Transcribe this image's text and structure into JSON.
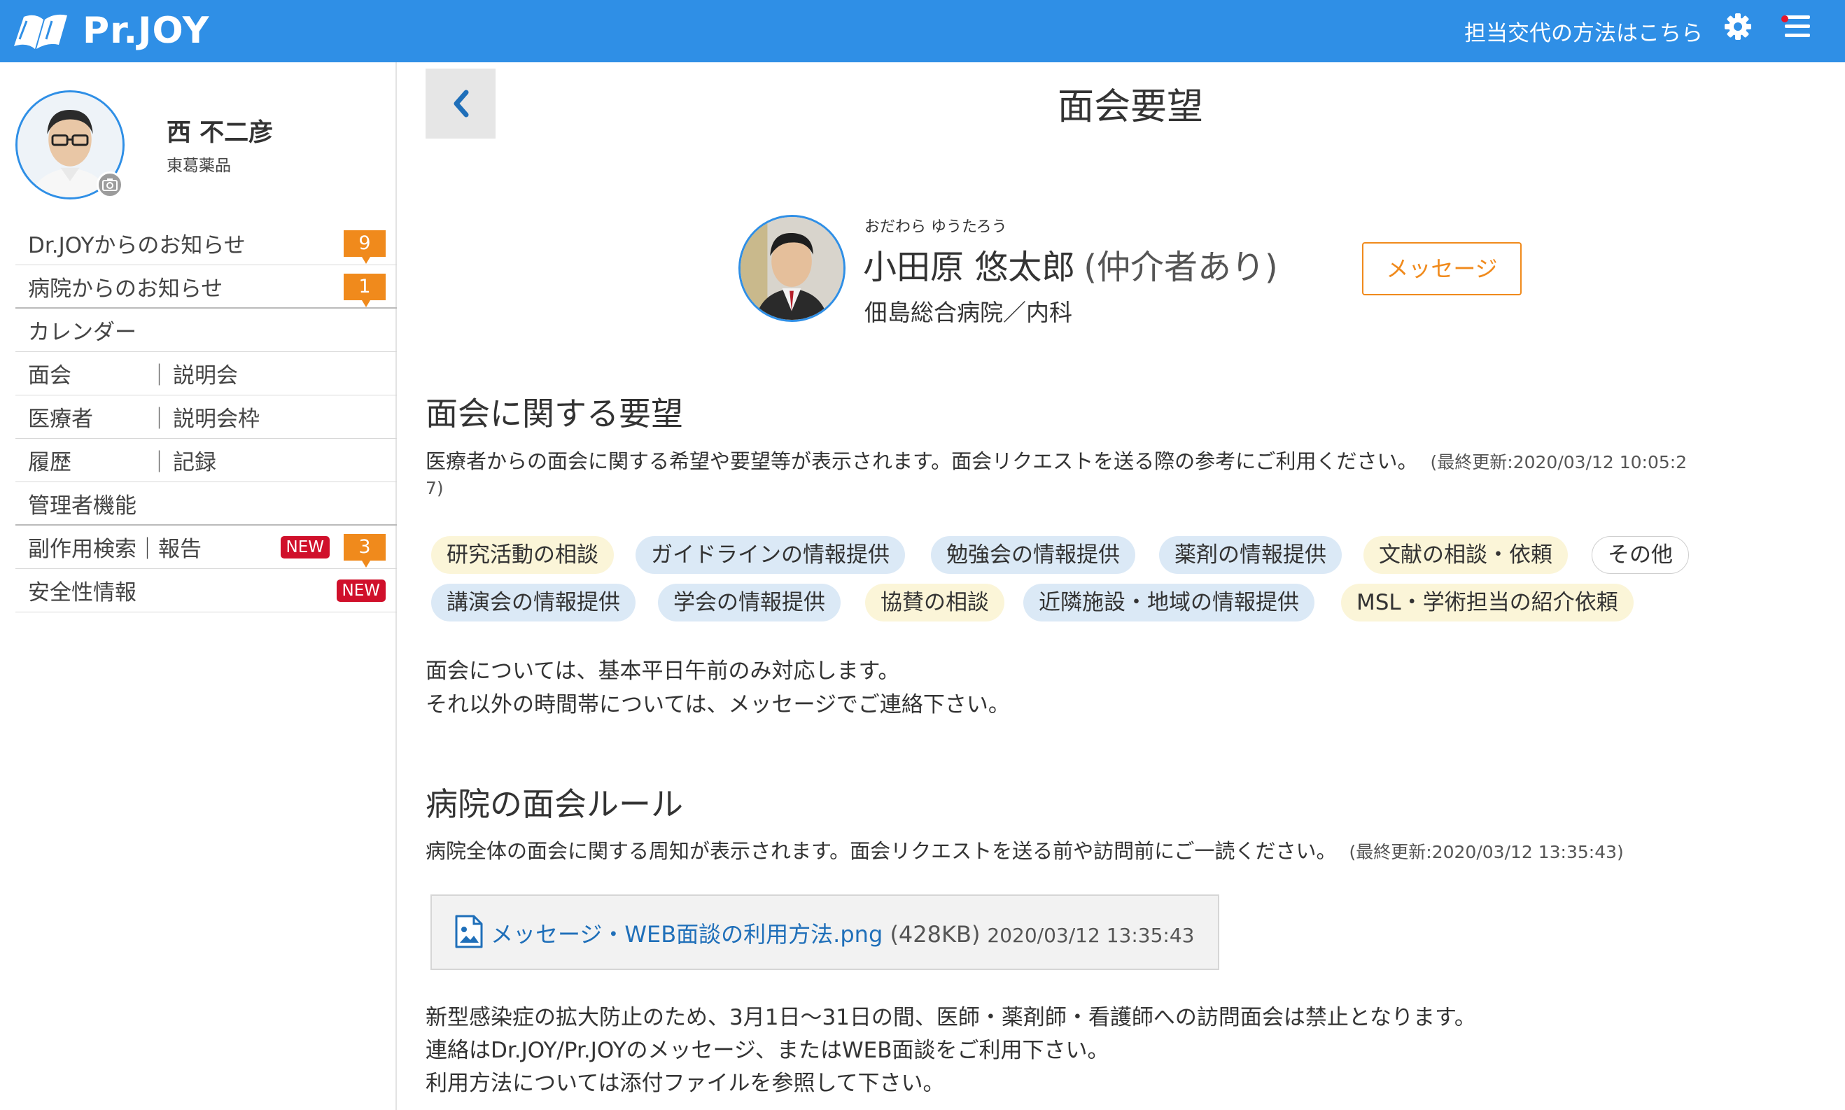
{
  "header": {
    "logo_text": "Pr.JOY",
    "change_link": "担当交代の方法はこちら",
    "settings_icon": "gear-icon",
    "menu_icon": "hamburger-menu-icon",
    "colors": {
      "primary": "#2f8fe6",
      "badge_orange": "#f08a1c",
      "badge_red": "#d0102b"
    }
  },
  "user": {
    "name": "西 不二彦",
    "company": "東葛薬品"
  },
  "sidebar": {
    "items": [
      {
        "label": "Dr.JOYからのお知らせ",
        "badge": "9"
      },
      {
        "label": "病院からのお知らせ",
        "badge": "1"
      },
      {
        "label": "カレンダー"
      },
      {
        "label": "面会",
        "sub": "説明会"
      },
      {
        "label": "医療者",
        "sub": "説明会枠"
      },
      {
        "label": "履歴",
        "sub": "記録"
      },
      {
        "label": "管理者機能"
      },
      {
        "label": "副作用検索｜報告",
        "new": "NEW",
        "badge": "3"
      },
      {
        "label": "安全性情報",
        "new": "NEW"
      }
    ]
  },
  "page": {
    "title": "面会要望"
  },
  "doctor": {
    "ruby": "おだわら ゆうたろう",
    "name": "小田原 悠太郎",
    "broker": "(仲介者あり)",
    "dept": "佃島総合病院／内科",
    "message_button": "メッセージ"
  },
  "requests": {
    "title": "面会に関する要望",
    "desc": "医療者からの面会に関する希望や要望等が表示されます。面会リクエストを送る際の参考にご利用ください。",
    "updated_1": "(最終更新:2020/03/12 10:05:2",
    "updated_2": "7)",
    "tags": [
      "研究活動の相談",
      "ガイドラインの情報提供",
      "勉強会の情報提供",
      "薬剤の情報提供",
      "文献の相談・依頼",
      "その他",
      "講演会の情報提供",
      "学会の情報提供",
      "協賛の相談",
      "近隣施設・地域の情報提供",
      "MSL・学術担当の紹介依頼"
    ],
    "note": [
      "面会については、基本平日午前のみ対応します。",
      "それ以外の時間帯については、メッセージでご連絡下さい。"
    ]
  },
  "rules": {
    "title": "病院の面会ルール",
    "desc": "病院全体の面会に関する周知が表示されます。面会リクエストを送る前や訪問前にご一読ください。",
    "updated": "(最終更新:2020/03/12 13:35:43)",
    "file": {
      "name": "メッセージ・WEB面談の利用方法.png",
      "size": "(428KB)",
      "date": "2020/03/12 13:35:43",
      "icon": "image-file-icon"
    },
    "body": [
      "新型感染症の拡大防止のため、3月1日〜31日の間、医師・薬剤師・看護師への訪問面会は禁止となります。",
      "連絡はDr.JOY/Pr.JOYのメッセージ、またはWEB面談をご利用下さい。",
      "利用方法については添付ファイルを参照して下さい。"
    ]
  }
}
